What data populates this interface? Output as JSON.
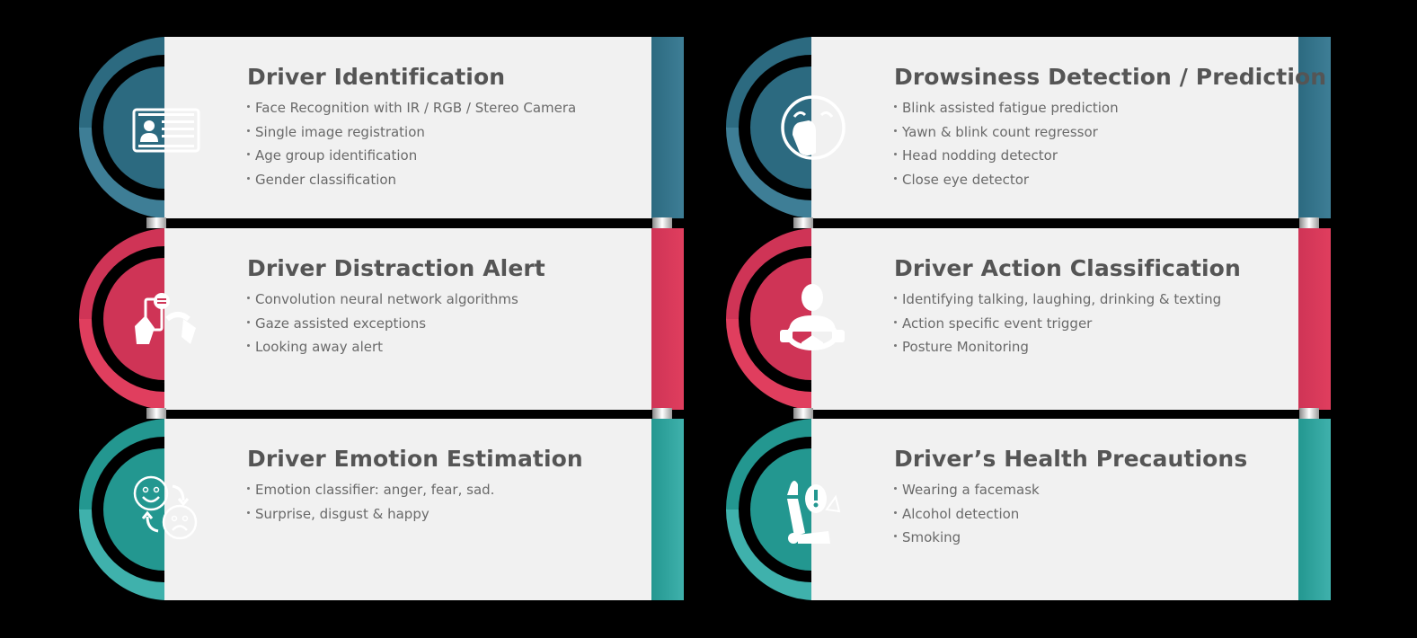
{
  "colors": {
    "blue": "#2c6a80",
    "blue_light": "#3e7e96",
    "red": "#cf3456",
    "red_light": "#e03e5e",
    "teal": "#239790",
    "teal_light": "#3fb1ac",
    "panel": "#f1f1f1",
    "text": "#555555"
  },
  "cards": [
    {
      "title": "Driver Identification",
      "icon": "id-card-icon",
      "color": "blue",
      "items": [
        "Face Recognition with IR / RGB / Stereo Camera",
        "Single image registration",
        "Age group identification",
        "Gender classification"
      ]
    },
    {
      "title": "Drowsiness Detection / Prediction",
      "icon": "yawning-face-icon",
      "color": "blue",
      "items": [
        "Blink assisted fatigue prediction",
        "Yawn & blink count regressor",
        "Head nodding detector",
        "Close eye detector"
      ]
    },
    {
      "title": "Driver Distraction Alert",
      "icon": "phone-distraction-icon",
      "color": "red",
      "items": [
        "Convolution neural network algorithms",
        "Gaze assisted exceptions",
        "Looking away alert"
      ]
    },
    {
      "title": "Driver Action Classification",
      "icon": "driver-steering-wheel-icon",
      "color": "red",
      "items": [
        "Identifying talking, laughing, drinking & texting",
        "Action specific event trigger",
        "Posture Monitoring"
      ]
    },
    {
      "title": "Driver Emotion Estimation",
      "icon": "emotion-switch-icon",
      "color": "teal",
      "items": [
        "Emotion classifier: anger, fear, sad.",
        "Surprise, disgust & happy"
      ]
    },
    {
      "title": "Driver’s Health Precautions",
      "icon": "seat-airbag-icon",
      "color": "teal",
      "items": [
        "Wearing a facemask",
        "Alcohol detection",
        "Smoking"
      ]
    }
  ]
}
